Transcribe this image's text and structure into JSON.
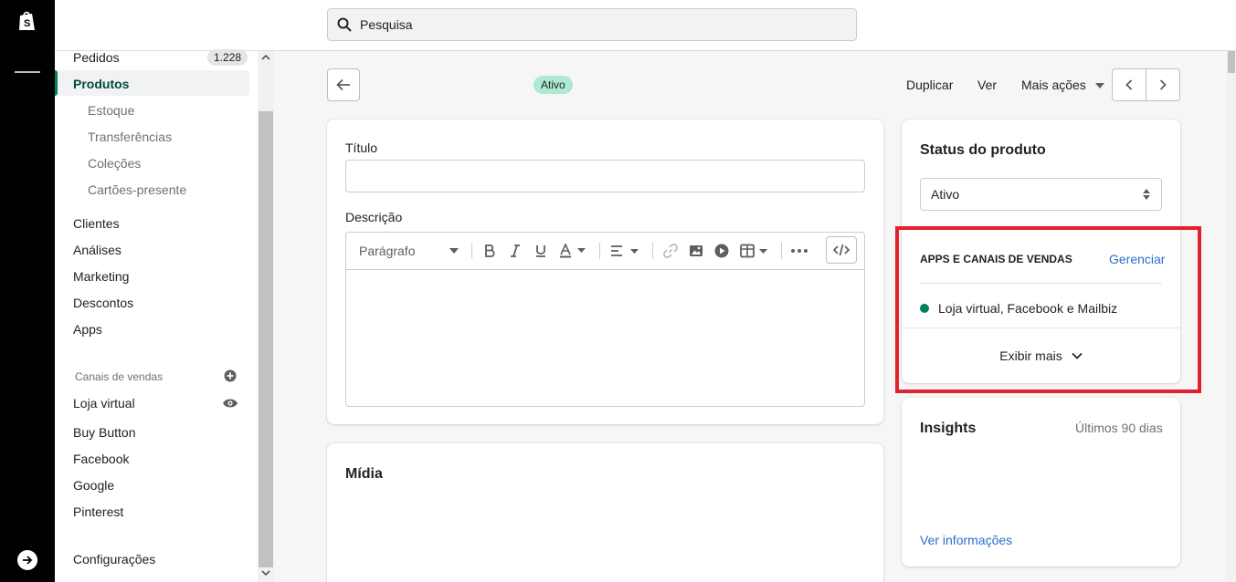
{
  "topbar": {
    "search_placeholder": "Pesquisa"
  },
  "sidebar": {
    "orders_label": "Pedidos",
    "orders_count": "1.228",
    "products_label": "Produtos",
    "products_sub": [
      "Estoque",
      "Transferências",
      "Coleções",
      "Cartões-presente"
    ],
    "items": [
      "Clientes",
      "Análises",
      "Marketing",
      "Descontos",
      "Apps"
    ],
    "sales_channels_title": "Canais de vendas",
    "channels": [
      "Loja virtual",
      "Buy Button",
      "Facebook",
      "Google",
      "Pinterest"
    ],
    "settings_label": "Configurações"
  },
  "header": {
    "status_badge": "Ativo",
    "duplicate": "Duplicar",
    "view": "Ver",
    "more_actions": "Mais ações"
  },
  "product_card": {
    "title_label": "Título",
    "title_value": "",
    "description_label": "Descrição",
    "paragraph_select": "Parágrafo"
  },
  "media_card": {
    "title": "Mídia"
  },
  "status_card": {
    "title": "Status do produto",
    "selected": "Ativo",
    "channels_heading": "APPS E CANAIS DE VENDAS",
    "manage_link": "Gerenciar",
    "channels_text": "Loja virtual, Facebook e Mailbiz",
    "show_more": "Exibir mais"
  },
  "insights_card": {
    "title": "Insights",
    "period": "Últimos 90 dias",
    "details_link": "Ver informações"
  },
  "colors": {
    "accent": "#008060",
    "highlight": "#e3202d",
    "link": "#2c6ecb"
  }
}
